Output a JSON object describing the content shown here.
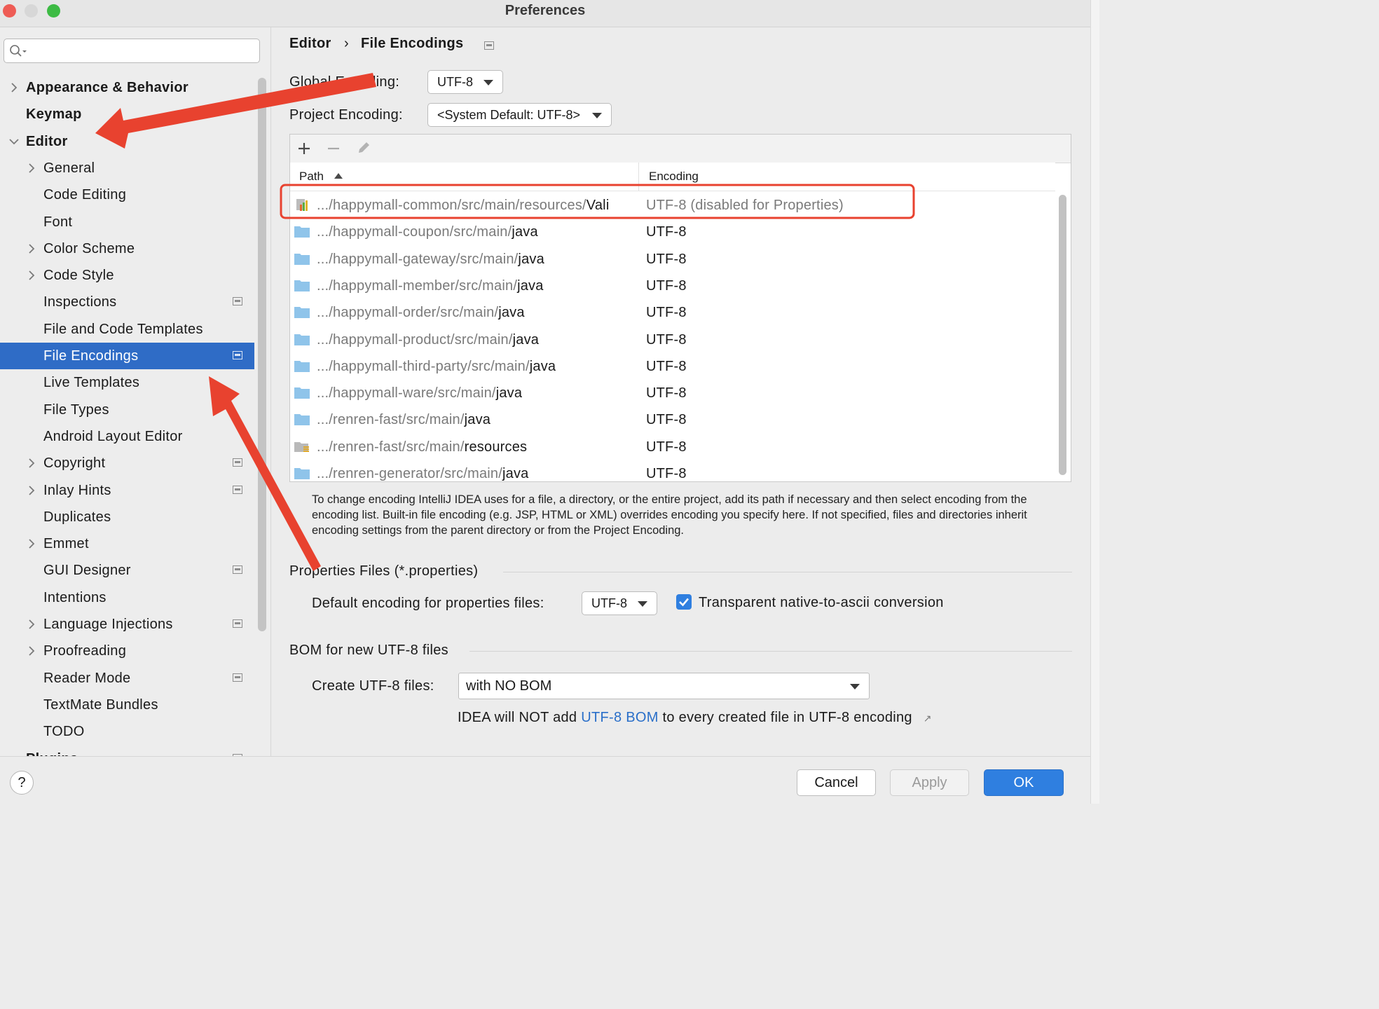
{
  "window": {
    "title": "Preferences"
  },
  "search": {
    "placeholder": ""
  },
  "sidebar": {
    "items": [
      {
        "label": "Appearance & Behavior",
        "level": 0,
        "expandable": true,
        "bold": true
      },
      {
        "label": "Keymap",
        "level": 0,
        "expandable": false,
        "bold": true
      },
      {
        "label": "Editor",
        "level": 0,
        "expandable": true,
        "expanded": true,
        "bold": true
      },
      {
        "label": "General",
        "level": 1,
        "expandable": true
      },
      {
        "label": "Code Editing",
        "level": 1
      },
      {
        "label": "Font",
        "level": 1
      },
      {
        "label": "Color Scheme",
        "level": 1,
        "expandable": true
      },
      {
        "label": "Code Style",
        "level": 1,
        "expandable": true
      },
      {
        "label": "Inspections",
        "level": 1,
        "project_icon": true
      },
      {
        "label": "File and Code Templates",
        "level": 1
      },
      {
        "label": "File Encodings",
        "level": 1,
        "project_icon": true,
        "selected": true
      },
      {
        "label": "Live Templates",
        "level": 1
      },
      {
        "label": "File Types",
        "level": 1
      },
      {
        "label": "Android Layout Editor",
        "level": 1
      },
      {
        "label": "Copyright",
        "level": 1,
        "expandable": true,
        "project_icon": true
      },
      {
        "label": "Inlay Hints",
        "level": 1,
        "expandable": true,
        "project_icon": true
      },
      {
        "label": "Duplicates",
        "level": 1
      },
      {
        "label": "Emmet",
        "level": 1,
        "expandable": true
      },
      {
        "label": "GUI Designer",
        "level": 1,
        "project_icon": true
      },
      {
        "label": "Intentions",
        "level": 1
      },
      {
        "label": "Language Injections",
        "level": 1,
        "expandable": true,
        "project_icon": true
      },
      {
        "label": "Proofreading",
        "level": 1,
        "expandable": true
      },
      {
        "label": "Reader Mode",
        "level": 1,
        "project_icon": true
      },
      {
        "label": "TextMate Bundles",
        "level": 1
      },
      {
        "label": "TODO",
        "level": 1
      },
      {
        "label": "Plugins",
        "level": 0,
        "bold": true,
        "project_icon": true
      }
    ]
  },
  "breadcrumb": {
    "parent": "Editor",
    "separator": "›",
    "current": "File Encodings"
  },
  "global_encoding": {
    "label": "Global Encoding:",
    "value": "UTF-8"
  },
  "project_encoding": {
    "label": "Project Encoding:",
    "value": "<System Default: UTF-8>"
  },
  "table": {
    "columns": [
      "Path",
      "Encoding"
    ],
    "rows": [
      {
        "prefix": ".../happymall-common/src/main/resources/",
        "name": "Vali",
        "encoding": "UTF-8 (disabled for Properties)",
        "icon": "properties-file-icon",
        "disabled": true
      },
      {
        "prefix": ".../happymall-coupon/src/main/",
        "name": "java",
        "encoding": "UTF-8",
        "icon": "folder-icon"
      },
      {
        "prefix": ".../happymall-gateway/src/main/",
        "name": "java",
        "encoding": "UTF-8",
        "icon": "folder-icon"
      },
      {
        "prefix": ".../happymall-member/src/main/",
        "name": "java",
        "encoding": "UTF-8",
        "icon": "folder-icon"
      },
      {
        "prefix": ".../happymall-order/src/main/",
        "name": "java",
        "encoding": "UTF-8",
        "icon": "folder-icon"
      },
      {
        "prefix": ".../happymall-product/src/main/",
        "name": "java",
        "encoding": "UTF-8",
        "icon": "folder-icon"
      },
      {
        "prefix": ".../happymall-third-party/src/main/",
        "name": "java",
        "encoding": "UTF-8",
        "icon": "folder-icon"
      },
      {
        "prefix": ".../happymall-ware/src/main/",
        "name": "java",
        "encoding": "UTF-8",
        "icon": "folder-icon"
      },
      {
        "prefix": ".../renren-fast/src/main/",
        "name": "java",
        "encoding": "UTF-8",
        "icon": "folder-icon"
      },
      {
        "prefix": ".../renren-fast/src/main/",
        "name": "resources",
        "encoding": "UTF-8",
        "icon": "resources-folder-icon"
      },
      {
        "prefix": ".../renren-generator/src/main/",
        "name": "java",
        "encoding": "UTF-8",
        "icon": "folder-icon"
      }
    ]
  },
  "help_text": "To change encoding IntelliJ IDEA uses for a file, a directory, or the entire project, add its path if necessary and then select encoding from the encoding list. Built-in file encoding (e.g. JSP, HTML or XML) overrides encoding you specify here. If not specified, files and directories inherit encoding settings from the parent directory or from the Project Encoding.",
  "properties": {
    "section_title": "Properties Files (*.properties)",
    "default_label": "Default encoding for properties files:",
    "default_value": "UTF-8",
    "native_to_ascii": {
      "label": "Transparent native-to-ascii conversion",
      "checked": true
    }
  },
  "bom": {
    "section_title": "BOM for new UTF-8 files",
    "create_label": "Create UTF-8 files:",
    "create_value": "with NO BOM",
    "note_before": "IDEA will NOT add ",
    "note_link": "UTF-8 BOM",
    "note_after": " to every created file in UTF-8 encoding",
    "note_arrow": "↗"
  },
  "buttons": {
    "cancel": "Cancel",
    "apply": "Apply",
    "ok": "OK",
    "help": "?"
  },
  "colors": {
    "selection": "#2f6cc6",
    "accent": "#2f7fe0",
    "annotation": "#e8422f",
    "link": "#2a6fc9",
    "folder": "#8fc4ea"
  }
}
